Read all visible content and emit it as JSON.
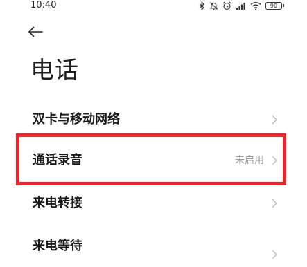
{
  "status_bar": {
    "time": "10:40",
    "icons": [
      "bluetooth-icon",
      "do-not-disturb-icon",
      "alarm-icon",
      "signal-icon",
      "wifi-icon",
      "battery-icon"
    ],
    "battery": "90"
  },
  "header": {
    "back_icon": "arrow-left-icon",
    "title": "电话"
  },
  "settings": {
    "items": [
      {
        "label": "双卡与移动网络",
        "value": ""
      },
      {
        "label": "通话录音",
        "value": "未启用"
      },
      {
        "label": "来电转接",
        "value": ""
      },
      {
        "label": "来电等待",
        "value": ""
      }
    ]
  },
  "annotation": {
    "highlight_color": "#e8262b",
    "highlighted_item": "通话录音"
  },
  "colors": {
    "text": "#1a1a1a",
    "secondary_text": "#9a9a9a",
    "chevron": "#b5b5b5",
    "background": "#ffffff"
  }
}
